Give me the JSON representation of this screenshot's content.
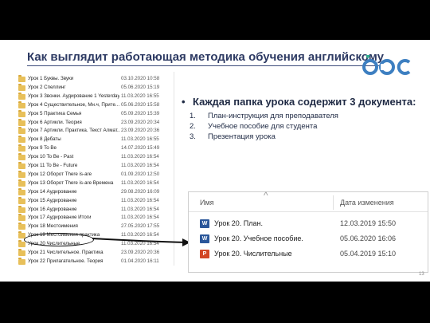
{
  "slide": {
    "title": "Как выглядит работающая методика обучения английскому",
    "page_number": "13"
  },
  "explorer": {
    "rows": [
      {
        "name": "Урок 1 Буквы. Звуки",
        "date": "03.10.2020 10:58"
      },
      {
        "name": "Урок 2 Спеллинг",
        "date": "05.06.2020 15:19"
      },
      {
        "name": "Урок 3 Звонки. Аудирование 1 Yesterday",
        "date": "11.03.2020 16:55"
      },
      {
        "name": "Урок 4 Существительное, Мн.ч, Прите...",
        "date": "05.06.2020 15:58"
      },
      {
        "name": "Урок 5 Практика Семья",
        "date": "05.09.2020 15:39"
      },
      {
        "name": "Урок 6 Артикли. Теория",
        "date": "23.09.2020 20:34"
      },
      {
        "name": "Урок 7 Артикли. Практика. Текст Алмат...",
        "date": "23.09.2020 20:36"
      },
      {
        "name": "Урок 8 Дебаты",
        "date": "11.03.2020 16:55"
      },
      {
        "name": "Урок 9 To Be",
        "date": "14.07.2020 15:49"
      },
      {
        "name": "Урок 10 To Be - Past",
        "date": "11.03.2020 16:54"
      },
      {
        "name": "Урок 11 To Be - Future",
        "date": "11.03.2020 16:54"
      },
      {
        "name": "Урок 12 Оборот There is-are",
        "date": "01.09.2020 12:50"
      },
      {
        "name": "Урок 13 Оборот There is-are Времена",
        "date": "11.03.2020 16:54"
      },
      {
        "name": "Урок 14 Аудирование",
        "date": "29.08.2020 16:09"
      },
      {
        "name": "Урок 15 Аудирование",
        "date": "11.03.2020 16:54"
      },
      {
        "name": "Урок 16 Аудирование",
        "date": "11.03.2020 16:54"
      },
      {
        "name": "Урок 17 Аудирование Итоги",
        "date": "11.03.2020 16:54"
      },
      {
        "name": "Урок 18 Местоимения",
        "date": "27.05.2020 17:55"
      },
      {
        "name": "Урок 19 Местоимения практика",
        "date": "11.03.2020 16:54"
      },
      {
        "name": "Урок 20 Числительные",
        "date": "11.03.2020 16:54"
      },
      {
        "name": "Урок 21 Числительное. Практика",
        "date": "23.09.2020 20:36"
      },
      {
        "name": "Урок 22 Прилагательное. Теория",
        "date": "01.04.2020 16:11"
      }
    ]
  },
  "bullets": {
    "main": "Каждая папка урока содержит 3 документа:",
    "items": [
      {
        "num": "1.",
        "text": "План-инструкция для преподавателя"
      },
      {
        "num": "2.",
        "text": "Учебное пособие для студента"
      },
      {
        "num": "3.",
        "text": "Презентация урока"
      }
    ]
  },
  "zoom": {
    "header_name": "Имя",
    "header_caret": "^",
    "header_date": "Дата изменения",
    "files": [
      {
        "name": "Урок 20. План.",
        "date": "12.03.2019 15:50",
        "icon": "word-icon",
        "icon_glyph": "W"
      },
      {
        "name": "Урок 20. Учебное пособие.",
        "date": "05.06.2020 16:06",
        "icon": "word-icon",
        "icon_glyph": "W"
      },
      {
        "name": "Урок 20. Числительные",
        "date": "05.04.2019 15:10",
        "icon": "powerpoint-icon",
        "icon_glyph": "P"
      }
    ]
  },
  "colors": {
    "title": "#2d3a63",
    "logo_blue": "#3d7fc1",
    "logo_green": "#2fae8f",
    "folder": "#e8c05a",
    "word": "#2b579a",
    "powerpoint": "#d24726"
  }
}
